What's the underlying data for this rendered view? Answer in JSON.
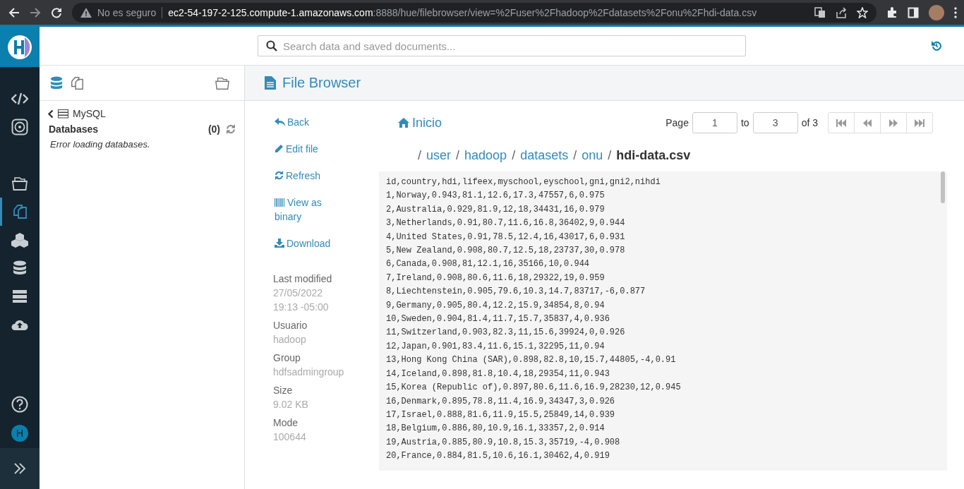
{
  "browser": {
    "security": "No es seguro",
    "url_host": "ec2-54-197-2-125.compute-1.amazonaws.com",
    "url_path": ":8888/hue/filebrowser/view=%2Fuser%2Fhadoop%2Fdatasets%2Fonu%2Fhdi-data.csv"
  },
  "nav": {
    "items": [
      {
        "selected": false
      },
      {
        "selected": false
      },
      {
        "selected": false
      },
      {
        "selected": true
      },
      {
        "selected": false
      },
      {
        "selected": false
      },
      {
        "selected": false
      },
      {
        "selected": false
      }
    ],
    "user_initial": "H"
  },
  "search": {
    "placeholder": "Search data and saved documents..."
  },
  "left_panel": {
    "source": "MySQL",
    "section": "Databases",
    "count": "(0)",
    "message": "Error loading databases."
  },
  "page_title": "File Browser",
  "actions": [
    {
      "label": "Back"
    },
    {
      "label": "Edit file"
    },
    {
      "label": "Refresh"
    },
    {
      "label": "View as binary"
    },
    {
      "label": "Download"
    }
  ],
  "meta": [
    {
      "label": "Last modified",
      "value": "27/05/2022 19:13 -05:00"
    },
    {
      "label": "Usuario",
      "value": "hadoop"
    },
    {
      "label": "Group",
      "value": "hdfsadmingroup"
    },
    {
      "label": "Size",
      "value": "9.02 KB"
    },
    {
      "label": "Mode",
      "value": "100644"
    }
  ],
  "home": "Inicio",
  "pager": {
    "label": "Page",
    "from": "1",
    "to_label": "to",
    "to": "3",
    "of": "of 3"
  },
  "breadcrumb": [
    {
      "separator": "/",
      "label": "user",
      "current": false
    },
    {
      "separator": "/",
      "label": "hadoop",
      "current": false
    },
    {
      "separator": "/",
      "label": "datasets",
      "current": false
    },
    {
      "separator": "/",
      "label": "onu",
      "current": false
    },
    {
      "separator": "/",
      "label": "hdi-data.csv",
      "current": true
    }
  ],
  "file_lines": [
    "id,country,hdi,lifeex,myschool,eyschool,gni,gni2,nihdi",
    "1,Norway,0.943,81.1,12.6,17.3,47557,6,0.975",
    "2,Australia,0.929,81.9,12,18,34431,16,0.979",
    "3,Netherlands,0.91,80.7,11.6,16.8,36402,9,0.944",
    "4,United States,0.91,78.5,12.4,16,43017,6,0.931",
    "5,New Zealand,0.908,80.7,12.5,18,23737,30,0.978",
    "6,Canada,0.908,81,12.1,16,35166,10,0.944",
    "7,Ireland,0.908,80.6,11.6,18,29322,19,0.959",
    "8,Liechtenstein,0.905,79.6,10.3,14.7,83717,-6,0.877",
    "9,Germany,0.905,80.4,12.2,15.9,34854,8,0.94",
    "10,Sweden,0.904,81.4,11.7,15.7,35837,4,0.936",
    "11,Switzerland,0.903,82.3,11,15.6,39924,0,0.926",
    "12,Japan,0.901,83.4,11.6,15.1,32295,11,0.94",
    "13,Hong Kong China (SAR),0.898,82.8,10,15.7,44805,-4,0.91",
    "14,Iceland,0.898,81.8,10.4,18,29354,11,0.943",
    "15,Korea (Republic of),0.897,80.6,11.6,16.9,28230,12,0.945",
    "16,Denmark,0.895,78.8,11.4,16.9,34347,3,0.926",
    "17,Israel,0.888,81.6,11.9,15.5,25849,14,0.939",
    "18,Belgium,0.886,80,10.9,16.1,33357,2,0.914",
    "19,Austria,0.885,80.9,10.8,15.3,35719,-4,0.908",
    "20,France,0.884,81.5,10.6,16.1,30462,4,0.919"
  ]
}
